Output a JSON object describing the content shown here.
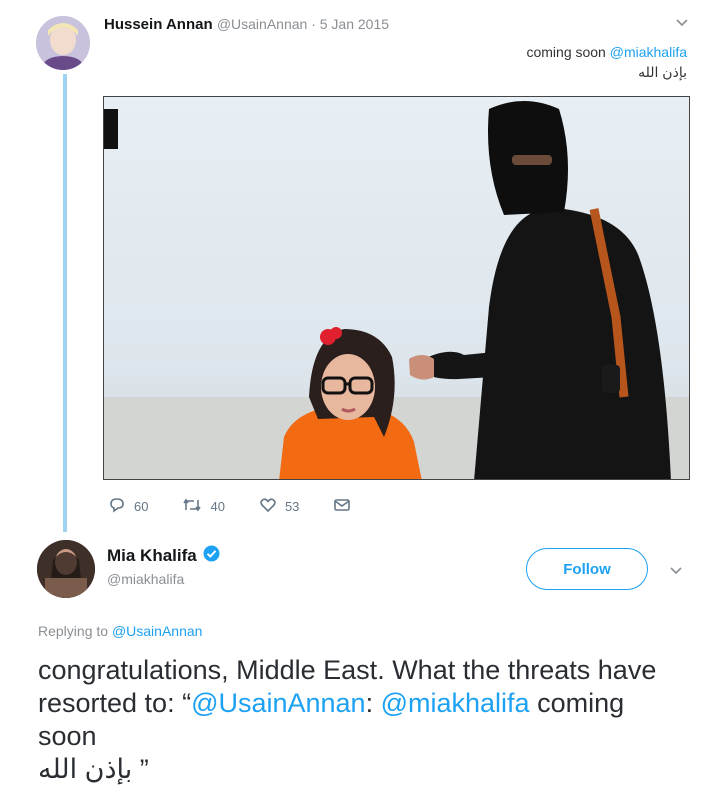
{
  "tweet1": {
    "name": "Hussein Annan",
    "meta": "@UsainAnnan · 5 Jan 2015",
    "text_prefix": "coming soon ",
    "mention": "@miakhalifa",
    "arabic": "بإذن الله",
    "actions": {
      "replies": "60",
      "retweets": "40",
      "likes": "53"
    }
  },
  "tweet2": {
    "name": "Mia Khalifa",
    "handle": "@miakhalifa",
    "follow_label": "Follow",
    "replying_prefix": "Replying to ",
    "replying_handle": "@UsainAnnan",
    "body_part1": "congratulations, Middle East. What the threats have resorted to: “",
    "mention1": "@UsainAnnan",
    "body_part2": ": ",
    "mention2": "@miakhalifa",
    "body_part3": " coming soon",
    "arabic": "بإذن الله",
    "quote_close": " ”"
  },
  "colors": {
    "link": "#1da1f2",
    "thread_line": "#9fd3f2",
    "verified": "#1da1f2"
  },
  "icons": [
    "reply-icon",
    "retweet-icon",
    "like-icon",
    "dm-icon",
    "verified-icon",
    "chevron-down-icon"
  ]
}
